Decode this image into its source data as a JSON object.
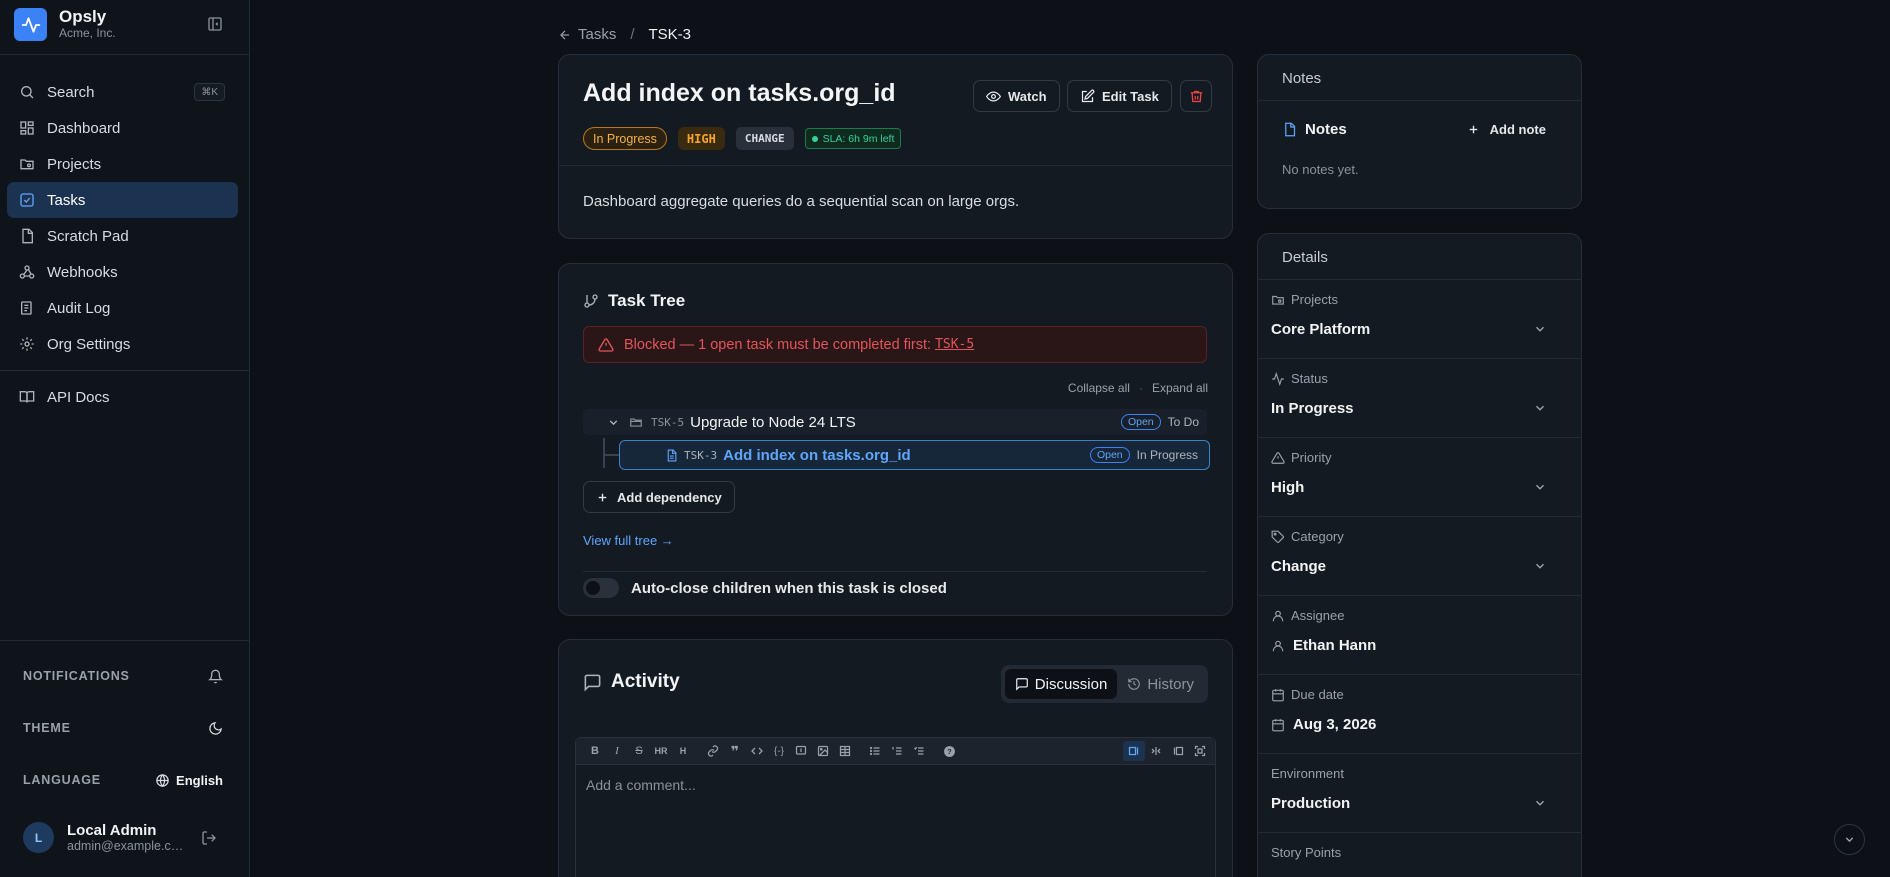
{
  "brand": {
    "name": "Opsly",
    "org": "Acme, Inc."
  },
  "nav": {
    "search": "Search",
    "search_shortcut": "⌘K",
    "items": [
      {
        "label": "Dashboard",
        "icon": "dashboard-icon"
      },
      {
        "label": "Projects",
        "icon": "projects-icon"
      },
      {
        "label": "Tasks",
        "icon": "tasks-icon",
        "active": true
      },
      {
        "label": "Scratch Pad",
        "icon": "scratch-pad-icon"
      },
      {
        "label": "Webhooks",
        "icon": "webhook-icon"
      },
      {
        "label": "Audit Log",
        "icon": "audit-log-icon"
      },
      {
        "label": "Org Settings",
        "icon": "gear-icon"
      }
    ],
    "api_docs": "API Docs"
  },
  "sidebar_settings": {
    "notifications": "NOTIFICATIONS",
    "theme": "THEME",
    "language_label": "LANGUAGE",
    "language_value": "English"
  },
  "user": {
    "initial": "L",
    "name": "Local Admin",
    "email": "admin@example.com"
  },
  "breadcrumb": {
    "back": "Tasks",
    "current": "TSK-3"
  },
  "task": {
    "title": "Add index on tasks.org_id",
    "watch_label": "Watch",
    "edit_label": "Edit Task",
    "status_badge": "In Progress",
    "priority_badge": "HIGH",
    "category_badge": "CHANGE",
    "sla_badge": "SLA: 6h 9m left",
    "description": "Dashboard aggregate queries do a sequential scan on large orgs."
  },
  "tree": {
    "title": "Task Tree",
    "blocked_text": "Blocked — 1 open task must be completed first:",
    "blocked_link": "TSK-5",
    "collapse_all": "Collapse all",
    "expand_all": "Expand all",
    "parent": {
      "key": "TSK-5",
      "title": "Upgrade to Node 24 LTS",
      "state": "Open",
      "status": "To Do"
    },
    "child": {
      "key": "TSK-3",
      "title": "Add index on tasks.org_id",
      "state": "Open",
      "status": "In Progress"
    },
    "add_dependency": "Add dependency",
    "view_full_tree": "View full tree →",
    "auto_close_label": "Auto-close children when this task is closed"
  },
  "activity": {
    "title": "Activity",
    "tab_discussion": "Discussion",
    "tab_history": "History",
    "comment_placeholder": "Add a comment..."
  },
  "notes": {
    "header": "Notes",
    "label": "Notes",
    "add_note": "Add note",
    "empty": "No notes yet."
  },
  "details": {
    "header": "Details",
    "fields": [
      {
        "label": "Projects",
        "value": "Core Platform"
      },
      {
        "label": "Status",
        "value": "In Progress"
      },
      {
        "label": "Priority",
        "value": "High"
      },
      {
        "label": "Category",
        "value": "Change"
      },
      {
        "label": "Assignee",
        "value": "Ethan Hann"
      },
      {
        "label": "Due date",
        "value": "Aug 3, 2026"
      },
      {
        "label": "Environment",
        "value": "Production"
      },
      {
        "label": "Story Points",
        "value": ""
      }
    ]
  },
  "colors": {
    "accent": "#3b82f6",
    "danger": "#ef4444",
    "warning": "#f5a524",
    "success": "#34d399"
  }
}
